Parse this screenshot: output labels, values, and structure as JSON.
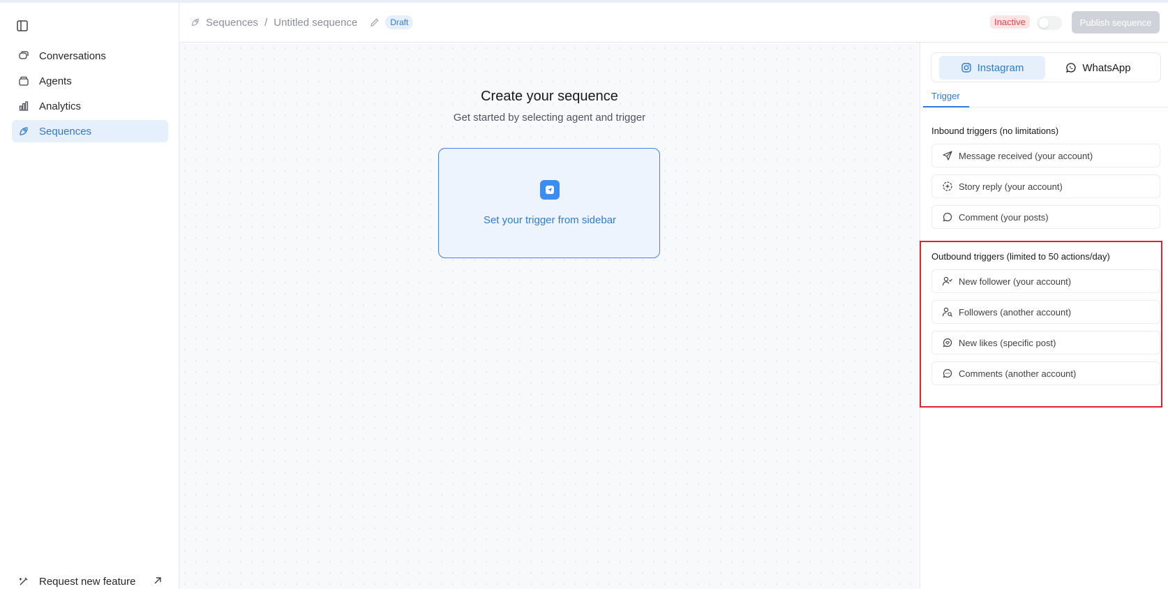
{
  "sidebar": {
    "items": [
      {
        "label": "Conversations",
        "icon": "conversations-icon",
        "active": false
      },
      {
        "label": "Agents",
        "icon": "agents-icon",
        "active": false
      },
      {
        "label": "Analytics",
        "icon": "analytics-icon",
        "active": false
      },
      {
        "label": "Sequences",
        "icon": "sequences-icon",
        "active": true
      }
    ],
    "request_feature": "Request new feature"
  },
  "header": {
    "breadcrumb_root": "Sequences",
    "breadcrumb_sep": "/",
    "breadcrumb_current": "Untitled sequence",
    "draft_badge": "Draft",
    "status": "Inactive",
    "publish_label": "Publish sequence"
  },
  "canvas": {
    "title": "Create your sequence",
    "subtitle": "Get started by selecting agent and trigger",
    "trigger_placeholder": "Set your trigger from sidebar"
  },
  "panel": {
    "channels": [
      "Instagram",
      "WhatsApp"
    ],
    "tab": "Trigger",
    "inbound_title": "Inbound triggers (no limitations)",
    "inbound": [
      {
        "label": "Message received (your account)",
        "icon": "send-icon"
      },
      {
        "label": "Story reply (your account)",
        "icon": "story-icon"
      },
      {
        "label": "Comment (your posts)",
        "icon": "comment-icon"
      }
    ],
    "outbound_title": "Outbound triggers (limited to 50 actions/day)",
    "outbound": [
      {
        "label": "New follower (your account)",
        "icon": "user-check-icon"
      },
      {
        "label": "Followers (another account)",
        "icon": "user-search-icon"
      },
      {
        "label": "New likes (specific post)",
        "icon": "heart-message-icon"
      },
      {
        "label": "Comments (another account)",
        "icon": "comment-dots-icon"
      }
    ]
  },
  "colors": {
    "accent": "#2f7bd9",
    "active_bg": "#e6effc",
    "inactive_text": "#e5484d",
    "highlight": "#e5202e"
  }
}
